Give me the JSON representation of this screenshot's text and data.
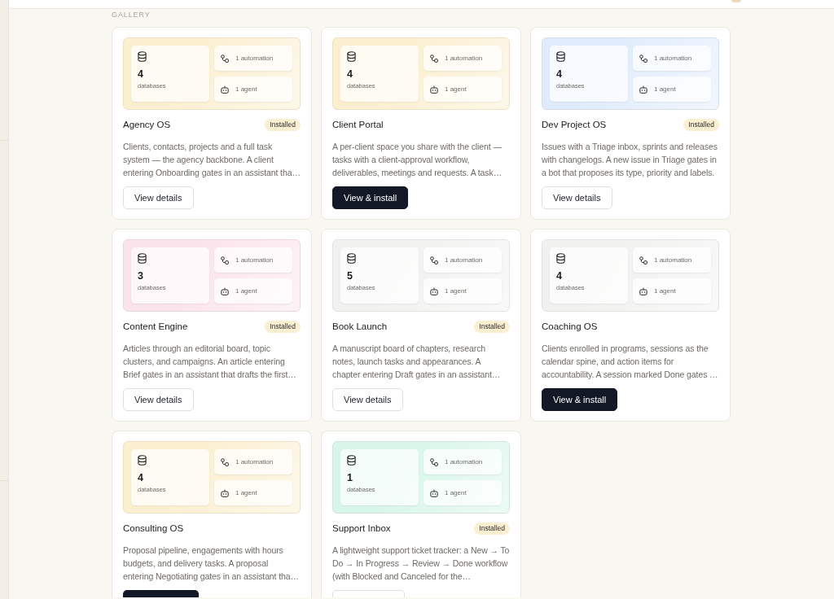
{
  "section_label": "GALLERY",
  "cards": [
    {
      "title": "Agency OS",
      "badge": "Installed",
      "color": "#fcefd0",
      "databases": "4",
      "databases_label": "databases",
      "automation": "1 automation",
      "agent": "1 agent",
      "description": "Clients, contacts, projects and a full task system — the agency backbone. A client entering Onboarding gates in an assistant tha…",
      "button": {
        "kind": "secondary",
        "label": "View details"
      }
    },
    {
      "title": "Client Portal",
      "color": "#fcefd0",
      "databases": "4",
      "databases_label": "databases",
      "automation": "1 automation",
      "agent": "1 agent",
      "description": "A per-client space you share with the client — tasks with a client-approval workflow, deliverables, meetings and requests. A task…",
      "button": {
        "kind": "primary",
        "label": "View & install"
      }
    },
    {
      "title": "Dev Project OS",
      "badge": "Installed",
      "color": "#e0ecfc",
      "databases": "4",
      "databases_label": "databases",
      "automation": "1 automation",
      "agent": "1 agent",
      "description": "Issues with a Triage inbox, sprints and releases with changelogs. A new issue in Triage gates in a bot that proposes its type, priority and labels.",
      "button": {
        "kind": "secondary",
        "label": "View details"
      }
    },
    {
      "title": "Content Engine",
      "badge": "Installed",
      "color": "#fbe3ec",
      "databases": "3",
      "databases_label": "databases",
      "automation": "1 automation",
      "agent": "1 agent",
      "description": "Articles through an editorial board, topic clusters, and campaigns. An article entering Brief gates in an assistant that drafts the first…",
      "button": {
        "kind": "secondary",
        "label": "View details"
      }
    },
    {
      "title": "Book Launch",
      "badge": "Installed",
      "color": "#f1f1f0",
      "databases": "5",
      "databases_label": "databases",
      "automation": "1 automation",
      "agent": "1 agent",
      "description": "A manuscript board of chapters, research notes, launch tasks and appearances. A chapter entering Draft gates in an assistant…",
      "button": {
        "kind": "secondary",
        "label": "View details"
      }
    },
    {
      "title": "Coaching OS",
      "color": "#f1f1f0",
      "databases": "4",
      "databases_label": "databases",
      "automation": "1 automation",
      "agent": "1 agent",
      "description": "Clients enrolled in programs, sessions as the calendar spine, and action items for accountability. A session marked Done gates …",
      "button": {
        "kind": "primary",
        "label": "View & install"
      }
    },
    {
      "title": "Consulting OS",
      "color": "#fcefd0",
      "databases": "4",
      "databases_label": "databases",
      "automation": "1 automation",
      "agent": "1 agent",
      "description": "Proposal pipeline, engagements with hours budgets, and delivery tasks. A proposal entering Negotiating gates in an assistant tha…",
      "button": {
        "kind": "primary"
      }
    },
    {
      "title": "Support Inbox",
      "badge": "Installed",
      "color": "#d8f5e9",
      "databases": "1",
      "databases_label": "databases",
      "automation": "1 automation",
      "agent": "1 agent",
      "description": "A lightweight support ticket tracker: a New → To Do → In Progress → Review → Done workflow (with Blocked and Canceled for the…",
      "button": {
        "kind": "secondary"
      }
    }
  ]
}
